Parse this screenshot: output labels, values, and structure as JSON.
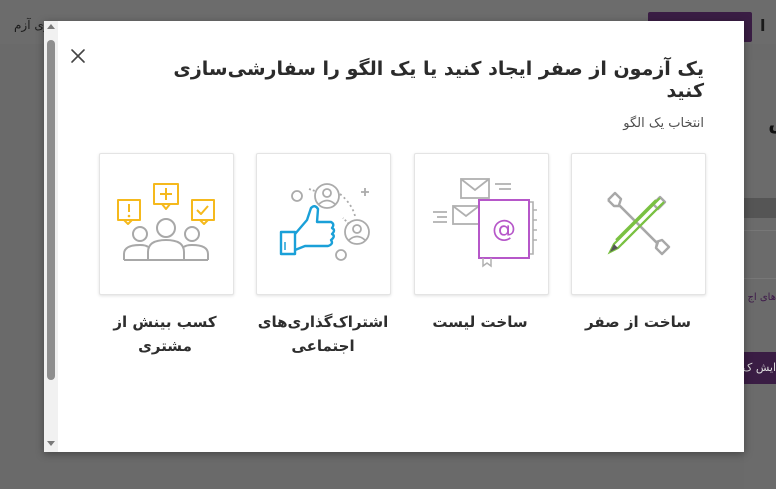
{
  "background": {
    "top_left_text": "ریزی آزم",
    "top_right_text": "ا",
    "heading": "نش",
    "link_text": "های اج",
    "button_text": "ایش ک"
  },
  "modal": {
    "title": "یک آزمون از صفر ایجاد کنید یا یک الگو را سفارشی‌سازی کنید",
    "section_label": "انتخاب یک الگو",
    "close_icon": "close-icon",
    "templates": [
      {
        "label": "ساخت از صفر",
        "icon": "tools-pencil-icon"
      },
      {
        "label": "ساخت لیست",
        "icon": "mail-list-icon"
      },
      {
        "label": "اشتراک‌گذاری‌های اجتماعی",
        "icon": "thumbs-up-icon"
      },
      {
        "label": "کسب بینش از مشتری",
        "icon": "customer-feedback-icon"
      }
    ]
  },
  "colors": {
    "overlay": "#6a6a6a",
    "brand_purple": "#3a1d44",
    "icon_green": "#7ac142",
    "icon_purple": "#b657c9",
    "icon_blue": "#1aa0d8",
    "icon_yellow": "#f5b91d",
    "icon_gray": "#9b9b9b"
  }
}
